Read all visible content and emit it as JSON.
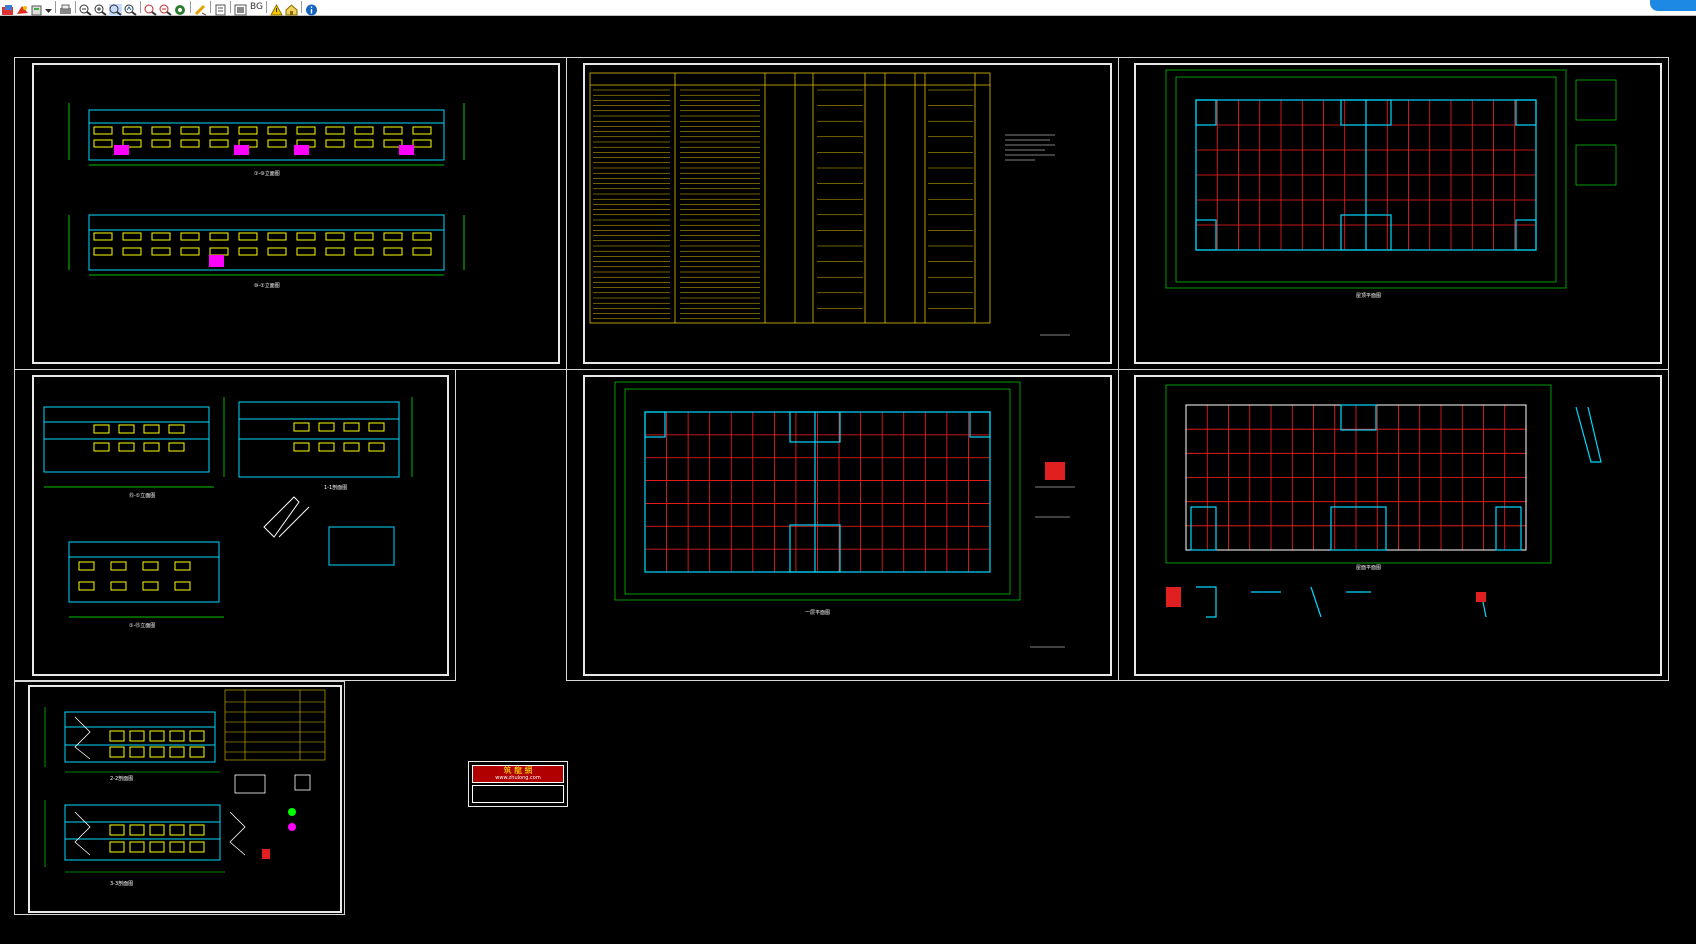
{
  "toolbar": {
    "icons": [
      "open-icon",
      "color-icon",
      "layers-icon",
      "dropdown-icon",
      "print-icon",
      "zoom-out-icon",
      "zoom-in-icon",
      "zoom-window-icon",
      "zoom-realtime-icon",
      "zoom-previous-icon",
      "zoom-next-icon",
      "pan-icon",
      "measure-icon",
      "text-icon",
      "layout-icon",
      "bg-label",
      "warning-icon",
      "home-icon",
      "info-icon"
    ],
    "bg_label": "BG"
  },
  "colors": {
    "background": "#000000",
    "frame": "#e8e8e8",
    "grid": "#ff2020",
    "dim": "#00ff00",
    "wall": "#00d8ff",
    "window": "#ffff00",
    "door": "#ff00ff",
    "table": "#e0c000"
  },
  "sheets": {
    "elevations_top": {
      "label": "elevations"
    },
    "design_notes": {
      "label": "design notes"
    },
    "floor_plan_top_right": {
      "label": "floor plan"
    },
    "side_elevations": {
      "label": "side elevations"
    },
    "floor_plan_middle": {
      "label": "floor plan"
    },
    "roof_plan": {
      "label": "roof plan"
    },
    "sections": {
      "label": "sections"
    }
  },
  "stamp": {
    "title": "筑 龍 網",
    "url": "www.zhulong.com",
    "note": ""
  }
}
